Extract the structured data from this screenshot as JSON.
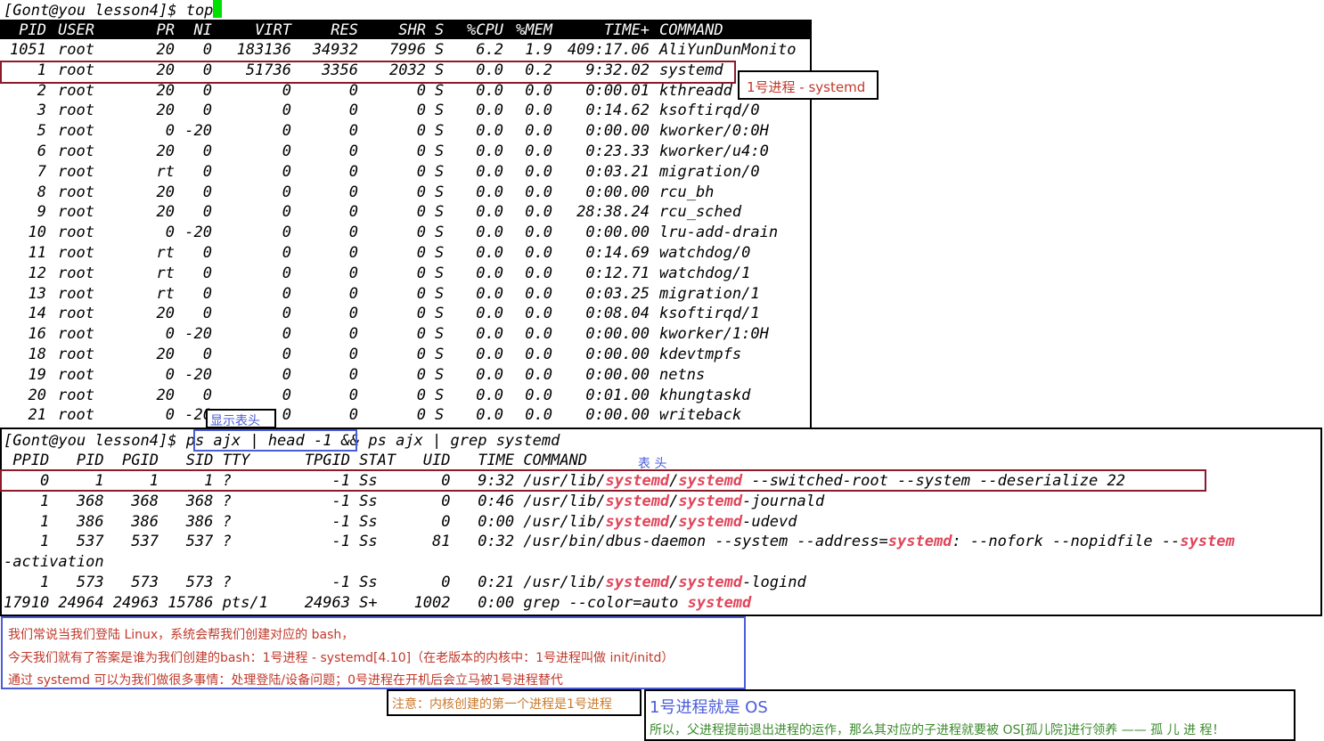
{
  "terminal_top": {
    "prompt": "[Gont@you lesson4]$ ",
    "command": "top",
    "columns": [
      "PID",
      "USER",
      "PR",
      "NI",
      "VIRT",
      "RES",
      "SHR",
      "S",
      "%CPU",
      "%MEM",
      "TIME+",
      "COMMAND"
    ],
    "rows": [
      [
        "1051",
        "root",
        "20",
        "0",
        "183136",
        "34932",
        "7996",
        "S",
        "6.2",
        "1.9",
        "409:17.06",
        "AliYunDunMonito"
      ],
      [
        "1",
        "root",
        "20",
        "0",
        "51736",
        "3356",
        "2032",
        "S",
        "0.0",
        "0.2",
        "9:32.02",
        "systemd"
      ],
      [
        "2",
        "root",
        "20",
        "0",
        "0",
        "0",
        "0",
        "S",
        "0.0",
        "0.0",
        "0:00.01",
        "kthreadd"
      ],
      [
        "3",
        "root",
        "20",
        "0",
        "0",
        "0",
        "0",
        "S",
        "0.0",
        "0.0",
        "0:14.62",
        "ksoftirqd/0"
      ],
      [
        "5",
        "root",
        "0",
        "-20",
        "0",
        "0",
        "0",
        "S",
        "0.0",
        "0.0",
        "0:00.00",
        "kworker/0:0H"
      ],
      [
        "6",
        "root",
        "20",
        "0",
        "0",
        "0",
        "0",
        "S",
        "0.0",
        "0.0",
        "0:23.33",
        "kworker/u4:0"
      ],
      [
        "7",
        "root",
        "rt",
        "0",
        "0",
        "0",
        "0",
        "S",
        "0.0",
        "0.0",
        "0:03.21",
        "migration/0"
      ],
      [
        "8",
        "root",
        "20",
        "0",
        "0",
        "0",
        "0",
        "S",
        "0.0",
        "0.0",
        "0:00.00",
        "rcu_bh"
      ],
      [
        "9",
        "root",
        "20",
        "0",
        "0",
        "0",
        "0",
        "S",
        "0.0",
        "0.0",
        "28:38.24",
        "rcu_sched"
      ],
      [
        "10",
        "root",
        "0",
        "-20",
        "0",
        "0",
        "0",
        "S",
        "0.0",
        "0.0",
        "0:00.00",
        "lru-add-drain"
      ],
      [
        "11",
        "root",
        "rt",
        "0",
        "0",
        "0",
        "0",
        "S",
        "0.0",
        "0.0",
        "0:14.69",
        "watchdog/0"
      ],
      [
        "12",
        "root",
        "rt",
        "0",
        "0",
        "0",
        "0",
        "S",
        "0.0",
        "0.0",
        "0:12.71",
        "watchdog/1"
      ],
      [
        "13",
        "root",
        "rt",
        "0",
        "0",
        "0",
        "0",
        "S",
        "0.0",
        "0.0",
        "0:03.25",
        "migration/1"
      ],
      [
        "14",
        "root",
        "20",
        "0",
        "0",
        "0",
        "0",
        "S",
        "0.0",
        "0.0",
        "0:08.04",
        "ksoftirqd/1"
      ],
      [
        "16",
        "root",
        "0",
        "-20",
        "0",
        "0",
        "0",
        "S",
        "0.0",
        "0.0",
        "0:00.00",
        "kworker/1:0H"
      ],
      [
        "18",
        "root",
        "20",
        "0",
        "0",
        "0",
        "0",
        "S",
        "0.0",
        "0.0",
        "0:00.00",
        "kdevtmpfs"
      ],
      [
        "19",
        "root",
        "0",
        "-20",
        "0",
        "0",
        "0",
        "S",
        "0.0",
        "0.0",
        "0:00.00",
        "netns"
      ],
      [
        "20",
        "root",
        "20",
        "0",
        "0",
        "0",
        "0",
        "S",
        "0.0",
        "0.0",
        "0:01.00",
        "khungtaskd"
      ],
      [
        "21",
        "root",
        "0",
        "-20",
        "0",
        "0",
        "0",
        "S",
        "0.0",
        "0.0",
        "0:00.00",
        "writeback"
      ]
    ]
  },
  "annotations": {
    "systemd_label": "1号进程 - systemd",
    "show_header_label": "显示表头",
    "header_label": "表 头"
  },
  "terminal_ps": {
    "prompt": "[Gont@you lesson4]$ ",
    "cmd_part1": "ps ajx | head -1",
    "cmd_part2": " && ps ajx | grep systemd",
    "header": " PPID   PID  PGID   SID TTY      TPGID STAT   UID   TIME COMMAND",
    "lines": [
      {
        "pre": "    0     1     1     1 ?           -1 Ss       0   9:32 /usr/lib/",
        "hl1": "systemd",
        "mid": "/",
        "hl2": "systemd",
        "post": " --switched-root --system --deserialize 22"
      },
      {
        "pre": "    1   368   368   368 ?           -1 Ss       0   0:46 /usr/lib/",
        "hl1": "systemd",
        "mid": "/",
        "hl2": "systemd",
        "post": "-journald"
      },
      {
        "pre": "    1   386   386   386 ?           -1 Ss       0   0:00 /usr/lib/",
        "hl1": "systemd",
        "mid": "/",
        "hl2": "systemd",
        "post": "-udevd"
      },
      {
        "pre": "    1   537   537   537 ?           -1 Ss      81   0:32 /usr/bin/dbus-daemon --system --address=",
        "hl1": "systemd",
        "mid": ": --nofork --nopidfile --",
        "hl2": "system",
        "post": ""
      },
      {
        "pre": "-activation",
        "hl1": "",
        "mid": "",
        "hl2": "",
        "post": ""
      },
      {
        "pre": "    1   573   573   573 ?           -1 Ss       0   0:21 /usr/lib/",
        "hl1": "systemd",
        "mid": "/",
        "hl2": "systemd",
        "post": "-logind"
      },
      {
        "pre": "17910 24964 24963 15786 pts/1    24963 S+    1002   0:00 grep --color=auto ",
        "hl1": "systemd",
        "mid": "",
        "hl2": "",
        "post": ""
      }
    ]
  },
  "notes": {
    "line1": "我们常说当我们登陆 Linux，系统会帮我们创建对应的 bash，",
    "line2": "今天我们就有了答案是谁为我们创建的bash：1号进程 - systemd[4.10]（在老版本的内核中：1号进程叫做 init/initd）",
    "line3": "通过 systemd 可以为我们做很多事情：处理登陆/设备问题；0号进程在开机后会立马被1号进程替代",
    "kernel_note": "注意：内核创建的第一个进程是1号进程",
    "os_title": "1号进程就是 OS",
    "os_line": "所以，父进程提前退出进程的运作，那么其对应的子进程就要被 OS[孤儿院]进行领养 —— 孤 儿 进 程！"
  },
  "colors": {
    "highlight_red": "#e0455a",
    "box_red": "#8b1a2b",
    "box_blue": "#4b5cd9",
    "cursor_green": "#00e000"
  }
}
